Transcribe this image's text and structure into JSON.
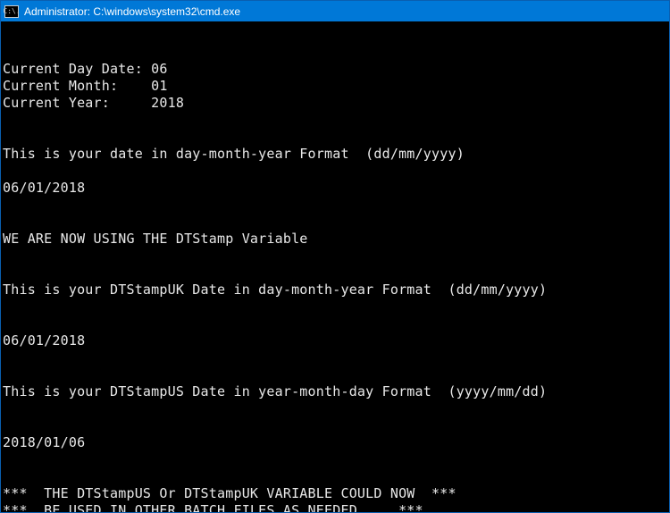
{
  "titlebar": {
    "icon_glyph": "C:\\.",
    "title": "Administrator: C:\\windows\\system32\\cmd.exe"
  },
  "lines": {
    "l01": "",
    "l02": "",
    "l03": "Current Day Date: 06",
    "l04": "Current Month:    01",
    "l05": "Current Year:     2018",
    "l06": "",
    "l07": "",
    "l08": "This is your date in day-month-year Format  (dd/mm/yyyy)",
    "l09": "",
    "l10": "06/01/2018",
    "l11": "",
    "l12": "",
    "l13": "WE ARE NOW USING THE DTStamp Variable",
    "l14": "",
    "l15": "",
    "l16": "This is your DTStampUK Date in day-month-year Format  (dd/mm/yyyy)",
    "l17": "",
    "l18": "",
    "l19": "06/01/2018",
    "l20": "",
    "l21": "",
    "l22": "This is your DTStampUS Date in year-month-day Format  (yyyy/mm/dd)",
    "l23": "",
    "l24": "",
    "l25": "2018/01/06",
    "l26": "",
    "l27": "",
    "l28": "***  THE DTStampUS Or DTStampUK VARIABLE COULD NOW  ***",
    "l29": "***  BE USED IN OTHER BATCH FILES AS NEEDED.    ***"
  }
}
